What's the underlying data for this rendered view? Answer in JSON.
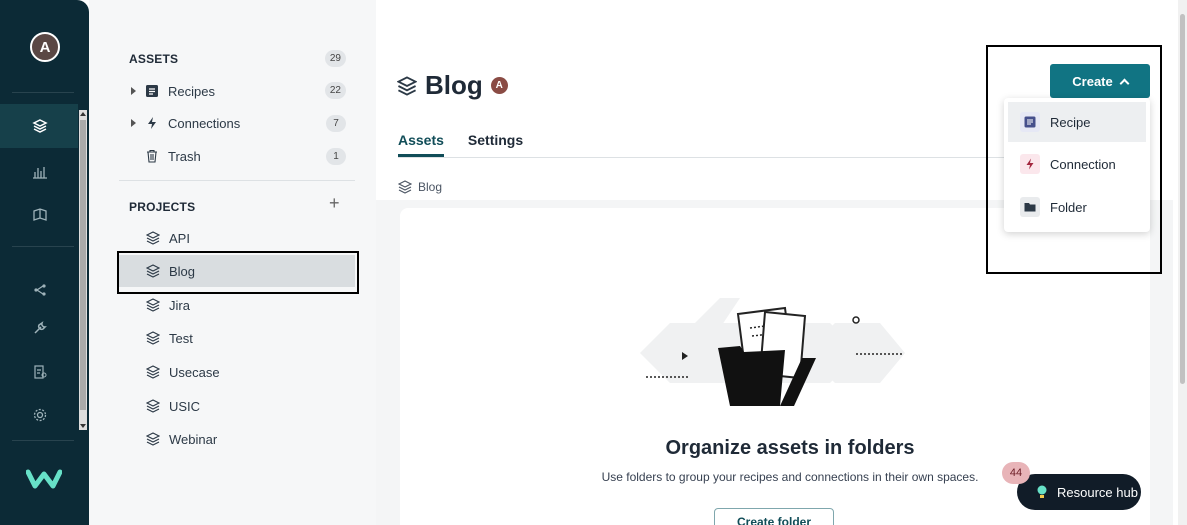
{
  "rail": {
    "avatar_letter": "A",
    "icons": [
      "projects-icon",
      "dashboard-icon",
      "docs-icon",
      "tools-icon",
      "wrench-icon",
      "lookup-icon",
      "settings-icon"
    ],
    "logo": "workato-logo"
  },
  "sidebar": {
    "assets_title": "ASSETS",
    "assets_count": "29",
    "asset_items": [
      {
        "label": "Recipes",
        "count": "22"
      },
      {
        "label": "Connections",
        "count": "7"
      },
      {
        "label": "Trash",
        "count": "1"
      }
    ],
    "projects_title": "PROJECTS",
    "projects_add": "+",
    "projects": [
      "API",
      "Blog",
      "Jira",
      "Test",
      "Usecase",
      "USIC",
      "Webinar"
    ],
    "active_project": "Blog"
  },
  "main": {
    "title": "Blog",
    "title_avatar": "A",
    "tabs": [
      {
        "label": "Assets",
        "active": true
      },
      {
        "label": "Settings",
        "active": false
      }
    ],
    "breadcrumb": "Blog",
    "empty_title": "Organize assets in folders",
    "empty_subtitle": "Use folders to group your recipes and connections in their own spaces.",
    "create_folder_label": "Create folder"
  },
  "create_menu": {
    "button_label": "Create",
    "items": [
      {
        "label": "Recipe",
        "icon": "recipe-icon"
      },
      {
        "label": "Connection",
        "icon": "connection-icon"
      },
      {
        "label": "Folder",
        "icon": "folder-icon"
      }
    ]
  },
  "resource_hub": {
    "label": "Resource hub",
    "badge": "44"
  },
  "colors": {
    "rail": "#0c2a36",
    "accent": "#117483",
    "sidebar": "#f6f7f8"
  }
}
